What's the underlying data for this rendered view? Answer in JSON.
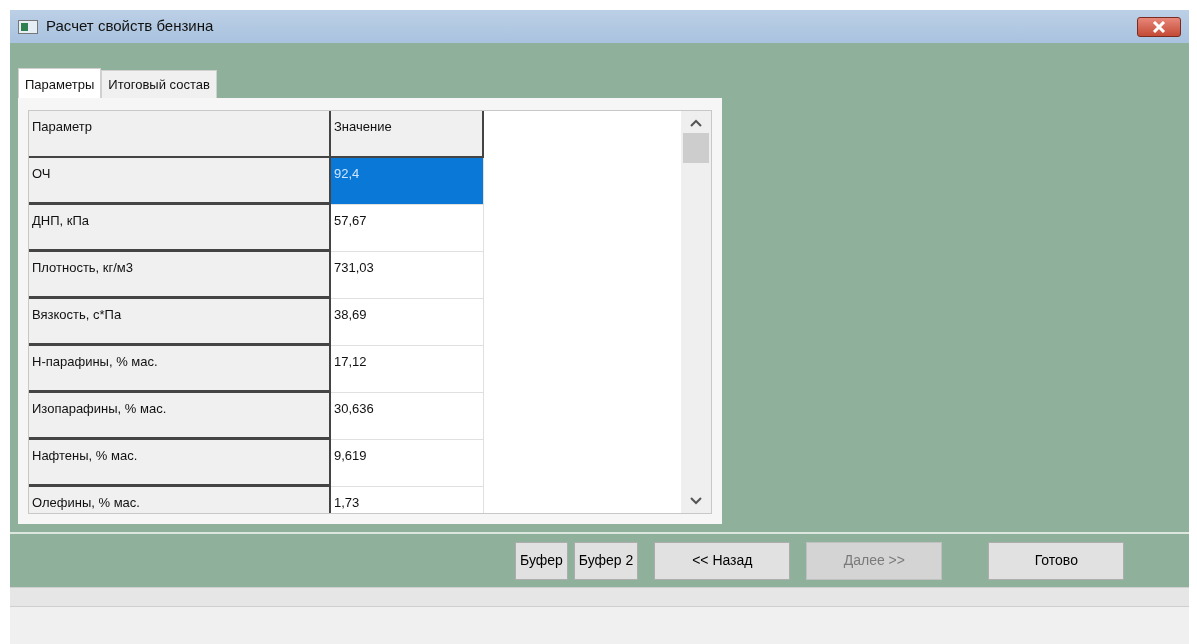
{
  "window": {
    "title": "Расчет свойств бензина"
  },
  "tabs": [
    {
      "label": "Параметры",
      "selected": true
    },
    {
      "label": "Итоговый состав",
      "selected": false
    }
  ],
  "table": {
    "columns": [
      "Параметр",
      "Значение"
    ],
    "rows": [
      {
        "parameter": "ОЧ",
        "value": "92,4",
        "selected": true
      },
      {
        "parameter": "ДНП, кПа",
        "value": "57,67",
        "selected": false
      },
      {
        "parameter": "Плотность, кг/м3",
        "value": "731,03",
        "selected": false
      },
      {
        "parameter": "Вязкость, с*Па",
        "value": "38,69",
        "selected": false
      },
      {
        "parameter": "Н-парафины, % мас.",
        "value": "17,12",
        "selected": false
      },
      {
        "parameter": "Изопарафины, % мас.",
        "value": "30,636",
        "selected": false
      },
      {
        "parameter": "Нафтены, % мас.",
        "value": "9,619",
        "selected": false
      },
      {
        "parameter": "Олефины, % мас.",
        "value": "1,73",
        "selected": false
      }
    ]
  },
  "buttons": [
    {
      "label": "Буфер",
      "disabled": false,
      "kind": "small"
    },
    {
      "label": "Буфер 2",
      "disabled": false,
      "kind": "small"
    },
    {
      "label": "<< Назад",
      "disabled": false,
      "kind": "wide"
    },
    {
      "label": "Далее >>",
      "disabled": true,
      "kind": "wide"
    },
    {
      "label": "Готово",
      "disabled": false,
      "kind": "wide"
    }
  ]
}
